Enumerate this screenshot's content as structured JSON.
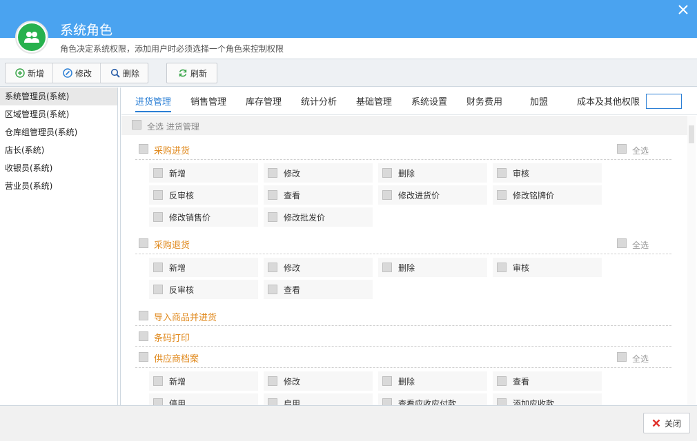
{
  "header": {
    "title": "系统角色",
    "subtitle": "角色决定系统权限，添加用户时必须选择一个角色来控制权限"
  },
  "toolbar": {
    "add": "新增",
    "edit": "修改",
    "delete": "删除",
    "refresh": "刷新"
  },
  "roles": [
    "系统管理员(系统)",
    "区域管理员(系统)",
    "仓库组管理员(系统)",
    "店长(系统)",
    "收银员(系统)",
    "营业员(系统)"
  ],
  "tabs": [
    "进货管理",
    "销售管理",
    "库存管理",
    "统计分析",
    "基础管理",
    "系统设置",
    "财务费用",
    "加盟",
    "成本及其他权限"
  ],
  "select_all_module": "全选 进货管理",
  "select_all": "全选",
  "sections": {
    "purchase": {
      "title": "采购进货",
      "perms": [
        "新增",
        "修改",
        "删除",
        "审核",
        "反审核",
        "查看",
        "修改进货价",
        "修改铭牌价",
        "修改销售价",
        "修改批发价"
      ]
    },
    "purchase_return": {
      "title": "采购退货",
      "perms": [
        "新增",
        "修改",
        "删除",
        "审核",
        "反审核",
        "查看"
      ]
    },
    "import": {
      "title": "导入商品并进货"
    },
    "barcode": {
      "title": "条码打印"
    },
    "supplier": {
      "title": "供应商档案",
      "perms": [
        "新增",
        "修改",
        "删除",
        "查看",
        "停用",
        "启用",
        "查看应收应付款",
        "添加应收款"
      ]
    }
  },
  "footer": {
    "close": "关闭"
  },
  "colors": {
    "header": "#4aa3f0",
    "accent": "#2b7fd5",
    "section": "#e0891d",
    "logo": "#27b14d",
    "close_icon": "#e0302a"
  }
}
